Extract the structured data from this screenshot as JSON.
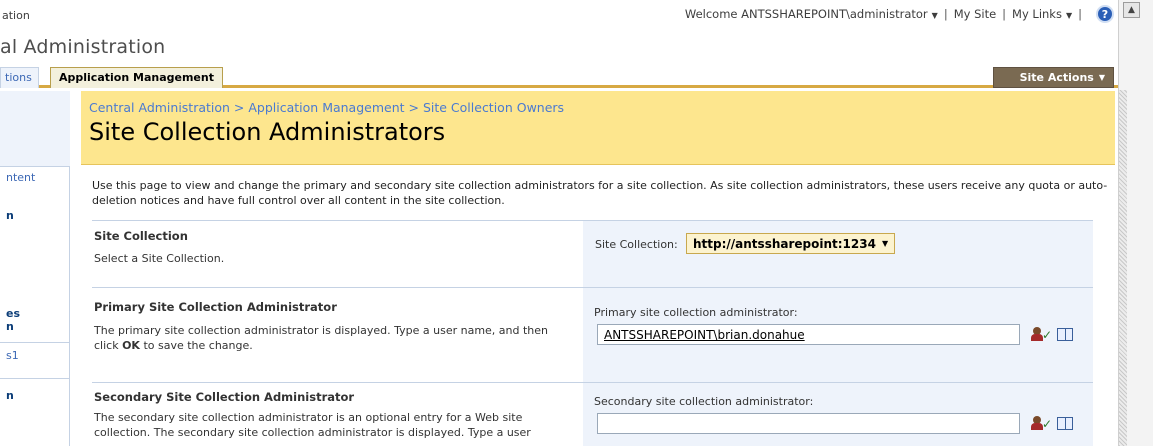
{
  "topbar": {
    "left_fragment": "ation",
    "welcome": "Welcome ANTSSHAREPOINT\\administrator",
    "my_site": "My Site",
    "my_links": "My Links",
    "help_glyph": "?"
  },
  "site_title": "al Administration",
  "tabs": {
    "operations_fragment": "tions",
    "application_management": "Application Management",
    "site_actions": "Site Actions"
  },
  "leftnav": {
    "items": [
      {
        "label": "ntent"
      },
      {
        "label": "n"
      },
      {
        "label": "es"
      },
      {
        "label": "n"
      },
      {
        "label": "s1"
      },
      {
        "label": "n"
      }
    ]
  },
  "page": {
    "breadcrumb": "Central Administration > Application Management > Site Collection Owners",
    "title": "Site Collection Administrators",
    "description": "Use this page to view and change the primary and secondary site collection administrators for a site collection. As site collection administrators, these users receive any quota or auto-deletion notices and have full control over all content in the site collection."
  },
  "sections": {
    "site_collection": {
      "title": "Site Collection",
      "description": "Select a Site Collection.",
      "field_label": "Site Collection:",
      "selected_value": "http://antssharepoint:1234"
    },
    "primary_admin": {
      "title": "Primary Site Collection Administrator",
      "description_before_bold": "The primary site collection administrator is displayed. Type a user name, and then click ",
      "description_bold": "OK",
      "description_after_bold": " to save the change.",
      "field_label": "Primary site collection administrator:",
      "value": "ANTSSHAREPOINT\\brian.donahue"
    },
    "secondary_admin": {
      "title": "Secondary Site Collection Administrator",
      "description": "The secondary site collection administrator is an optional entry for a Web site collection. The secondary site collection administrator is displayed. Type a user",
      "field_label": "Secondary site collection administrator:",
      "value": ""
    }
  },
  "icons": {
    "check_people": "check-names-icon",
    "browse": "address-book-icon"
  },
  "colors": {
    "header_band": "#fde68e",
    "tab_underline": "#d7a943",
    "site_actions_bg": "#7a6a52",
    "link_blue": "#3c68b5"
  }
}
